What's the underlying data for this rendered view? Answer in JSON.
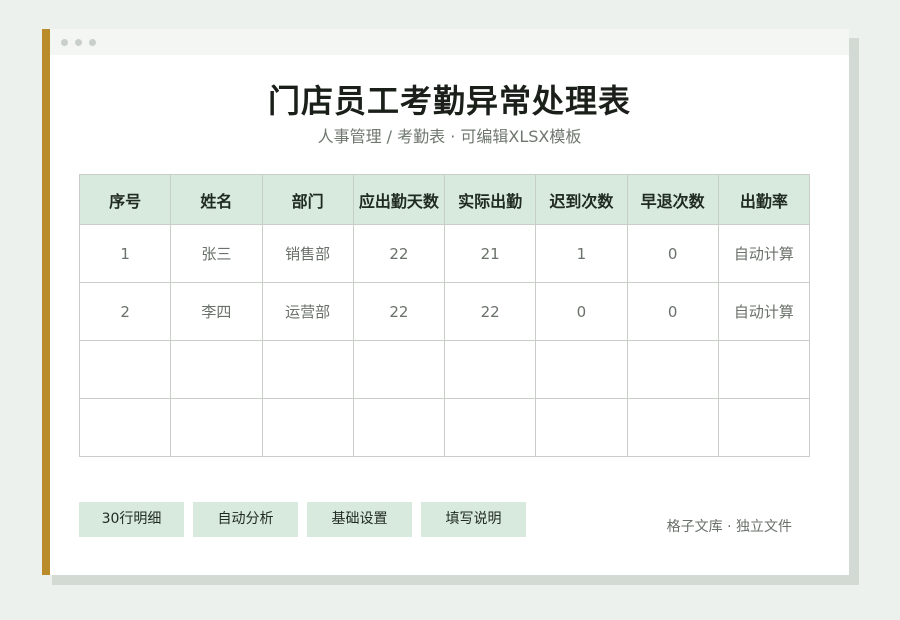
{
  "title": "门店员工考勤异常处理表",
  "subtitle": "人事管理 / 考勤表 · 可编辑XLSX模板",
  "table": {
    "headers": [
      "序号",
      "姓名",
      "部门",
      "应出勤天数",
      "实际出勤",
      "迟到次数",
      "早退次数",
      "出勤率"
    ],
    "rows": [
      [
        "1",
        "张三",
        "销售部",
        "22",
        "21",
        "1",
        "0",
        "自动计算"
      ],
      [
        "2",
        "李四",
        "运营部",
        "22",
        "22",
        "0",
        "0",
        "自动计算"
      ],
      [
        "",
        "",
        "",
        "",
        "",
        "",
        "",
        ""
      ],
      [
        "",
        "",
        "",
        "",
        "",
        "",
        "",
        ""
      ]
    ]
  },
  "buttons": {
    "b0": "30行明细",
    "b1": "自动分析",
    "b2": "基础设置",
    "b3": "填写说明"
  },
  "footer": "格子文库 · 独立文件",
  "colors": {
    "accent": "#b98b2a",
    "header_bg": "#d8e9de",
    "page_bg": "#edf1ed"
  }
}
